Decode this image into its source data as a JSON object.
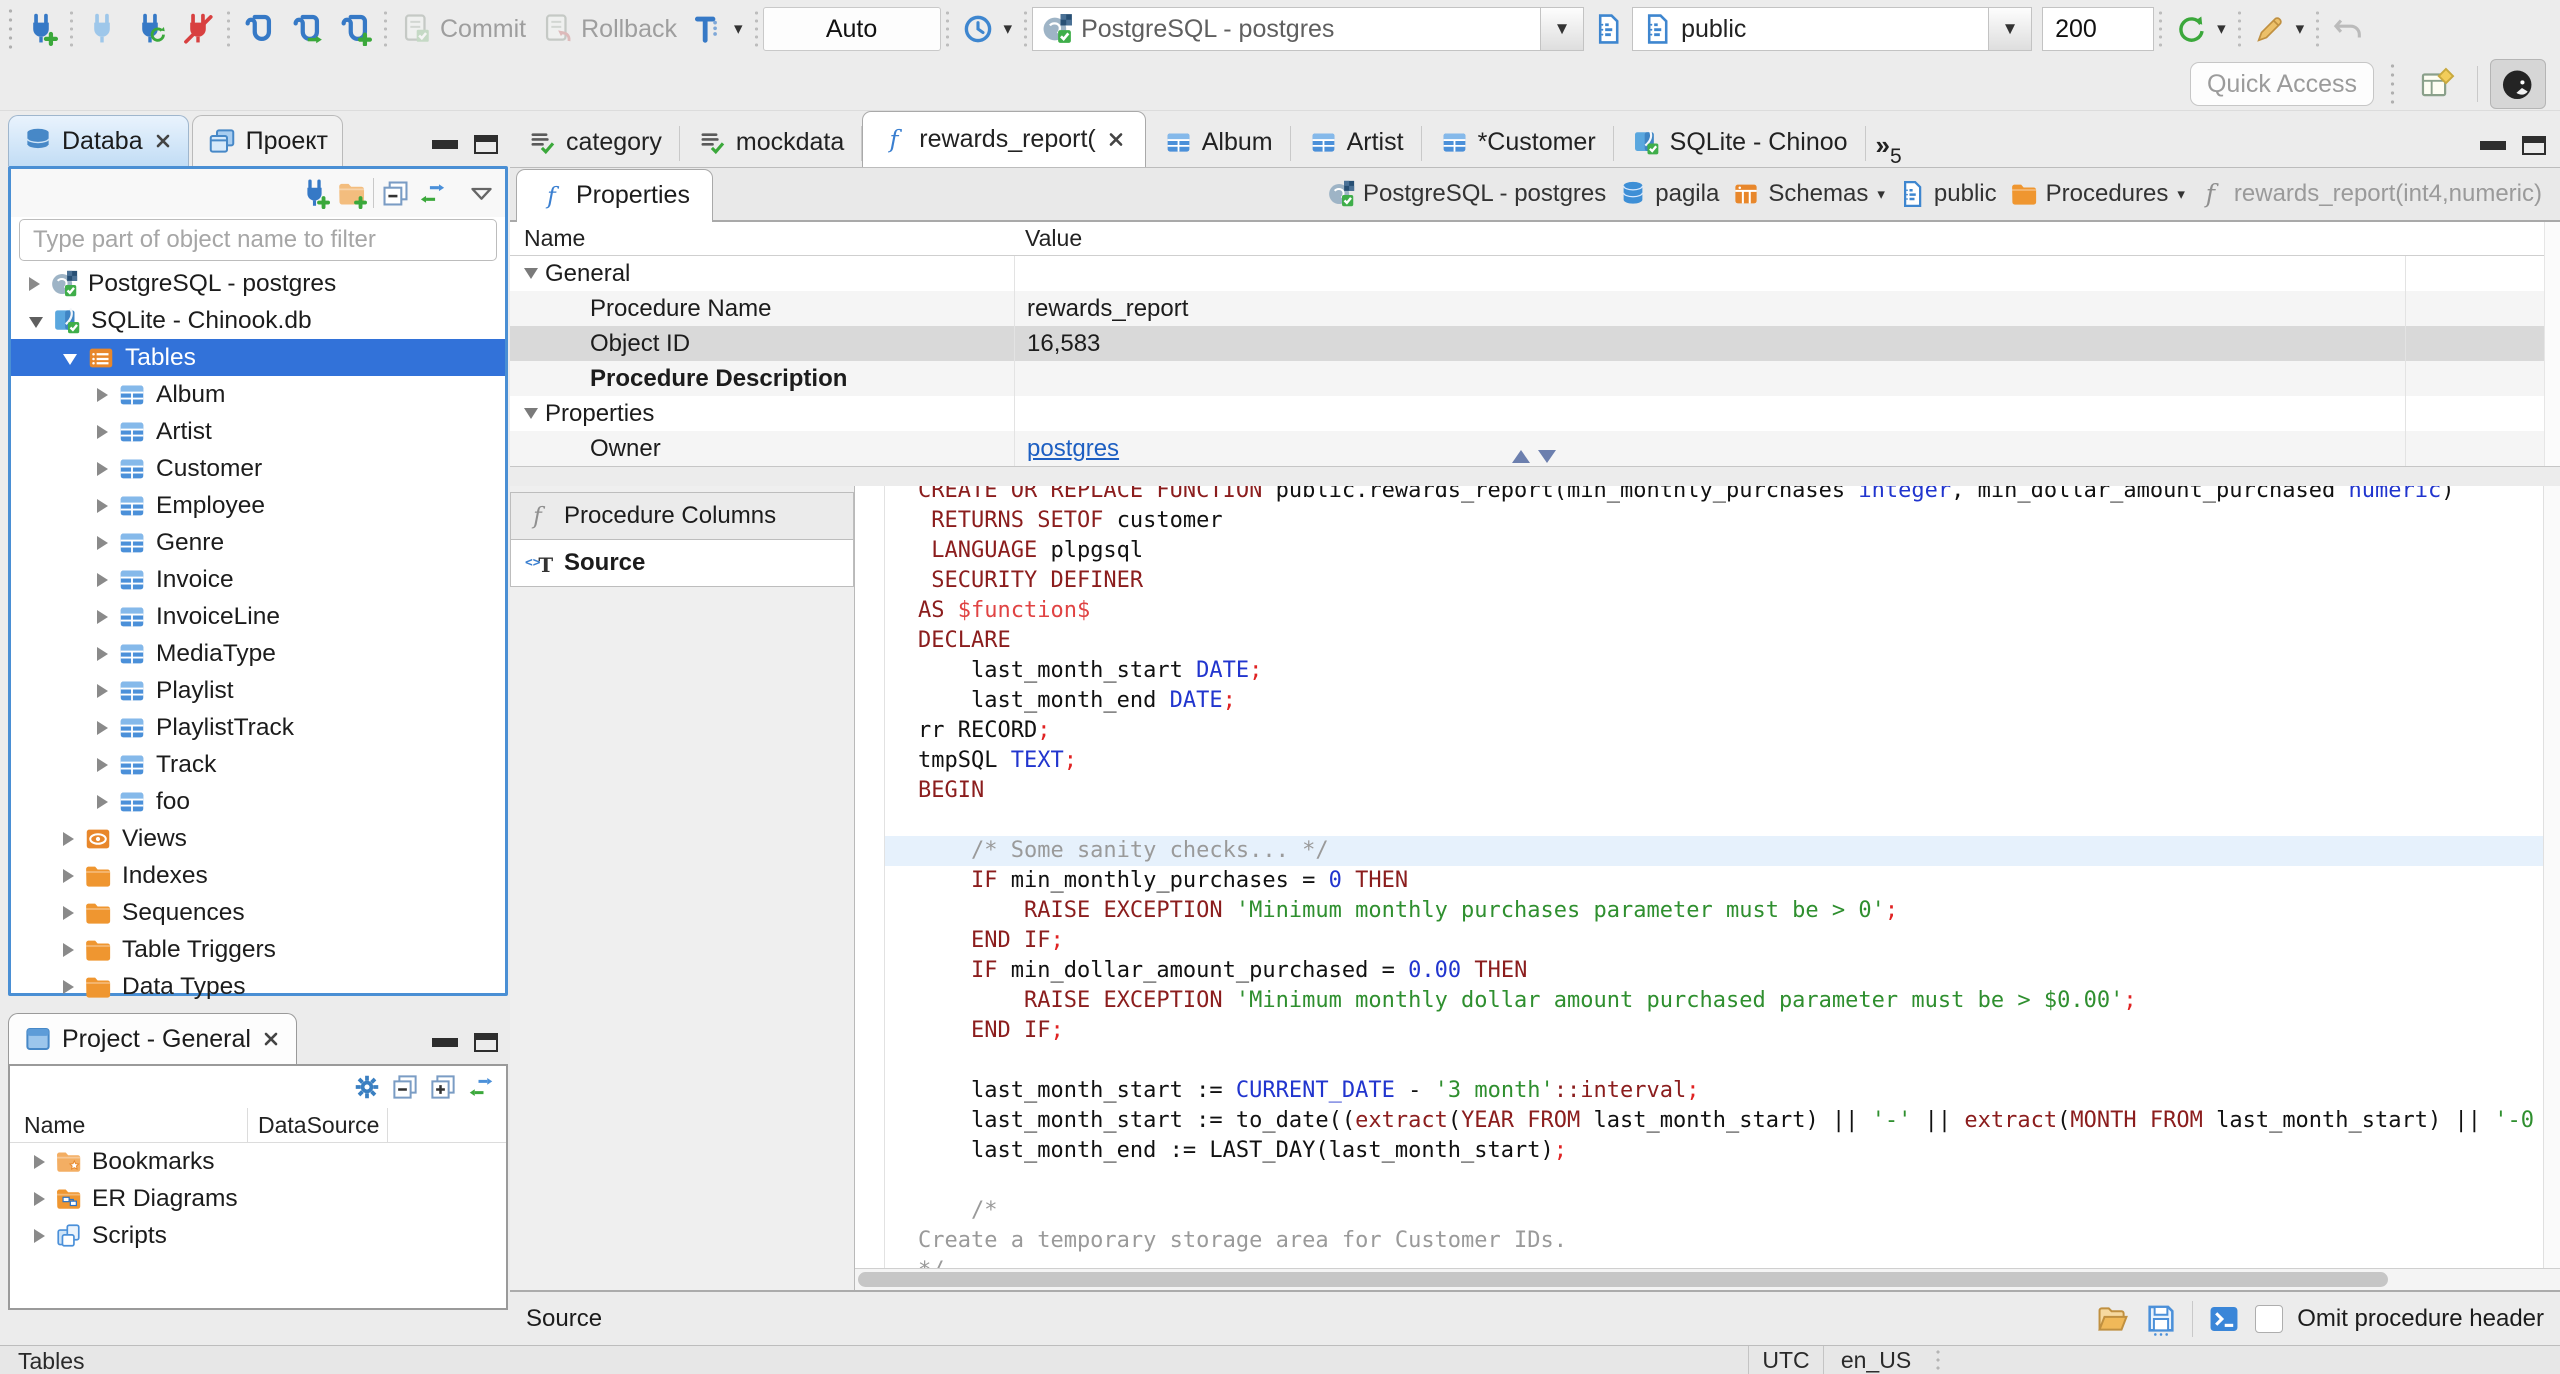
{
  "toolbar": {
    "commit_label": "Commit",
    "rollback_label": "Rollback",
    "auto_label": "Auto",
    "connection_combo": "PostgreSQL - postgres",
    "schema_combo": "public",
    "limit_value": "200",
    "quick_access_placeholder": "Quick Access"
  },
  "left_tabs": [
    {
      "label": "Databa",
      "icon": "database-stack",
      "closable": true,
      "active": true
    },
    {
      "label": "Проект",
      "icon": "project-windows",
      "active": false
    }
  ],
  "navigator": {
    "filter_placeholder": "Type part of object name to filter",
    "tree": [
      {
        "label": "PostgreSQL - postgres",
        "icon": "postgres-connection",
        "depth": 0,
        "state": "collapsed"
      },
      {
        "label": "SQLite - Chinook.db",
        "icon": "sqlite-connection",
        "depth": 0,
        "state": "expanded"
      },
      {
        "label": "Tables",
        "icon": "tables-folder",
        "depth": 1,
        "state": "expanded",
        "selected": true
      },
      {
        "label": "Album",
        "icon": "table",
        "depth": 2,
        "state": "collapsed"
      },
      {
        "label": "Artist",
        "icon": "table",
        "depth": 2,
        "state": "collapsed"
      },
      {
        "label": "Customer",
        "icon": "table",
        "depth": 2,
        "state": "collapsed"
      },
      {
        "label": "Employee",
        "icon": "table",
        "depth": 2,
        "state": "collapsed"
      },
      {
        "label": "Genre",
        "icon": "table",
        "depth": 2,
        "state": "collapsed"
      },
      {
        "label": "Invoice",
        "icon": "table",
        "depth": 2,
        "state": "collapsed"
      },
      {
        "label": "InvoiceLine",
        "icon": "table",
        "depth": 2,
        "state": "collapsed"
      },
      {
        "label": "MediaType",
        "icon": "table",
        "depth": 2,
        "state": "collapsed"
      },
      {
        "label": "Playlist",
        "icon": "table",
        "depth": 2,
        "state": "collapsed"
      },
      {
        "label": "PlaylistTrack",
        "icon": "table",
        "depth": 2,
        "state": "collapsed"
      },
      {
        "label": "Track",
        "icon": "table",
        "depth": 2,
        "state": "collapsed"
      },
      {
        "label": "foo",
        "icon": "table",
        "depth": 2,
        "state": "collapsed"
      },
      {
        "label": "Views",
        "icon": "views",
        "depth": 1,
        "state": "collapsed"
      },
      {
        "label": "Indexes",
        "icon": "folder",
        "depth": 1,
        "state": "collapsed"
      },
      {
        "label": "Sequences",
        "icon": "folder",
        "depth": 1,
        "state": "collapsed"
      },
      {
        "label": "Table Triggers",
        "icon": "folder",
        "depth": 1,
        "state": "collapsed"
      },
      {
        "label": "Data Types",
        "icon": "folder",
        "depth": 1,
        "state": "collapsed"
      }
    ]
  },
  "project_panel": {
    "tab_label": "Project - General",
    "columns": [
      "Name",
      "DataSource"
    ],
    "items": [
      {
        "label": "Bookmarks",
        "icon": "bookmarks-folder"
      },
      {
        "label": "ER Diagrams",
        "icon": "er-diagrams-folder"
      },
      {
        "label": "Scripts",
        "icon": "scripts"
      }
    ]
  },
  "editor_tabs": [
    {
      "label": "category",
      "icon": "sql-script-check"
    },
    {
      "label": "mockdata",
      "icon": "sql-script-check"
    },
    {
      "label": "rewards_report(",
      "icon": "function-blue",
      "active": true,
      "closable": true
    },
    {
      "label": "Album",
      "icon": "table"
    },
    {
      "label": "Artist",
      "icon": "table"
    },
    {
      "label": "*Customer",
      "icon": "table"
    },
    {
      "label": "SQLite - Chinoo",
      "icon": "sqlite-file"
    }
  ],
  "editor_tabs_overflow": {
    "symbol": "»",
    "count": "5"
  },
  "properties_view": {
    "tab_label": "Properties",
    "columns": [
      "Name",
      "Value"
    ],
    "breadcrumb": [
      {
        "label": "PostgreSQL - postgres",
        "icon": "postgres-connection"
      },
      {
        "label": "pagila",
        "icon": "database-blue"
      },
      {
        "label": "Schemas",
        "icon": "schemas-grid",
        "caret": true
      },
      {
        "label": "public",
        "icon": "schema-document"
      },
      {
        "label": "Procedures",
        "icon": "folder",
        "caret": true
      },
      {
        "label": "rewards_report(int4,numeric)",
        "icon": "function-gray",
        "dim": true
      }
    ],
    "rows": [
      {
        "name": "General",
        "group": true
      },
      {
        "name": "Procedure Name",
        "value": "rewards_report",
        "shade": true
      },
      {
        "name": "Object ID",
        "value": "16,583",
        "selected": true
      },
      {
        "name": "Procedure Description",
        "bold": true,
        "shade": true
      },
      {
        "name": "Properties",
        "group": true
      },
      {
        "name": "Owner",
        "value": "postgres",
        "link": true,
        "shade": true
      }
    ]
  },
  "detail_tabs": [
    {
      "label": "Procedure Columns",
      "icon": "function-gray"
    },
    {
      "label": "Source",
      "icon": "source-code",
      "active": true
    }
  ],
  "source_editor": {
    "lines": [
      {
        "segs": [
          [
            "kw",
            "CREATE OR REPLACE FUNCTION "
          ],
          [
            "pl",
            "public.rewards_report(min_monthly_purchases "
          ],
          [
            "ty",
            "integer"
          ],
          [
            "pl",
            ", min_dollar_amount_purchased "
          ],
          [
            "ty",
            "numeric"
          ],
          [
            "pl",
            ")"
          ]
        ]
      },
      {
        "segs": [
          [
            "kw",
            " RETURNS SETOF "
          ],
          [
            "pl",
            "customer"
          ]
        ]
      },
      {
        "segs": [
          [
            "kw",
            " LANGUAGE "
          ],
          [
            "pl",
            "plpgsql"
          ]
        ]
      },
      {
        "segs": [
          [
            "kw",
            " SECURITY DEFINER"
          ]
        ]
      },
      {
        "segs": [
          [
            "kw",
            "AS "
          ],
          [
            "fn",
            "$function$"
          ]
        ]
      },
      {
        "segs": [
          [
            "kw",
            "DECLARE"
          ]
        ]
      },
      {
        "segs": [
          [
            "pl",
            "    last_month_start "
          ],
          [
            "ty",
            "DATE"
          ],
          [
            "pu",
            ";"
          ]
        ]
      },
      {
        "segs": [
          [
            "pl",
            "    last_month_end "
          ],
          [
            "ty",
            "DATE"
          ],
          [
            "pu",
            ";"
          ]
        ]
      },
      {
        "segs": [
          [
            "pl",
            "rr RECORD"
          ],
          [
            "pu",
            ";"
          ]
        ]
      },
      {
        "segs": [
          [
            "pl",
            "tmpSQL "
          ],
          [
            "ty",
            "TEXT"
          ],
          [
            "pu",
            ";"
          ]
        ]
      },
      {
        "segs": [
          [
            "kw",
            "BEGIN"
          ]
        ]
      },
      {
        "segs": []
      },
      {
        "hl": true,
        "segs": [
          [
            "cm",
            "    /* Some sanity checks... */"
          ]
        ]
      },
      {
        "segs": [
          [
            "pl",
            "    "
          ],
          [
            "kw",
            "IF"
          ],
          [
            "pl",
            " min_monthly_purchases = "
          ],
          [
            "nu",
            "0"
          ],
          [
            "pl",
            " "
          ],
          [
            "kw",
            "THEN"
          ]
        ]
      },
      {
        "segs": [
          [
            "pl",
            "        "
          ],
          [
            "kw",
            "RAISE EXCEPTION "
          ],
          [
            "st",
            "'Minimum monthly purchases parameter must be > 0'"
          ],
          [
            "pu",
            ";"
          ]
        ]
      },
      {
        "segs": [
          [
            "pl",
            "    "
          ],
          [
            "kw",
            "END IF"
          ],
          [
            "pu",
            ";"
          ]
        ]
      },
      {
        "segs": [
          [
            "pl",
            "    "
          ],
          [
            "kw",
            "IF"
          ],
          [
            "pl",
            " min_dollar_amount_purchased = "
          ],
          [
            "nu",
            "0.00"
          ],
          [
            "pl",
            " "
          ],
          [
            "kw",
            "THEN"
          ]
        ]
      },
      {
        "segs": [
          [
            "pl",
            "        "
          ],
          [
            "kw",
            "RAISE EXCEPTION "
          ],
          [
            "st",
            "'Minimum monthly dollar amount purchased parameter must be > $0.00'"
          ],
          [
            "pu",
            ";"
          ]
        ]
      },
      {
        "segs": [
          [
            "pl",
            "    "
          ],
          [
            "kw",
            "END IF"
          ],
          [
            "pu",
            ";"
          ]
        ]
      },
      {
        "segs": []
      },
      {
        "segs": [
          [
            "pl",
            "    last_month_start := "
          ],
          [
            "ty",
            "CURRENT_DATE"
          ],
          [
            "pl",
            " - "
          ],
          [
            "st",
            "'3 month'"
          ],
          [
            "kw",
            "::interval"
          ],
          [
            "pu",
            ";"
          ]
        ]
      },
      {
        "segs": [
          [
            "pl",
            "    last_month_start := to_date(("
          ],
          [
            "kw",
            "extract"
          ],
          [
            "pl",
            "("
          ],
          [
            "kw",
            "YEAR FROM"
          ],
          [
            "pl",
            " last_month_start) || "
          ],
          [
            "st",
            "'-'"
          ],
          [
            "pl",
            " || "
          ],
          [
            "kw",
            "extract"
          ],
          [
            "pl",
            "("
          ],
          [
            "kw",
            "MONTH FROM"
          ],
          [
            "pl",
            " last_month_start) || "
          ],
          [
            "st",
            "'-0"
          ]
        ]
      },
      {
        "segs": [
          [
            "pl",
            "    last_month_end := LAST_DAY(last_month_start)"
          ],
          [
            "pu",
            ";"
          ]
        ]
      },
      {
        "segs": []
      },
      {
        "segs": [
          [
            "cm",
            "    /*"
          ]
        ]
      },
      {
        "segs": [
          [
            "cm",
            "Create a temporary storage area for Customer IDs."
          ]
        ]
      },
      {
        "segs": [
          [
            "cm",
            "*/"
          ]
        ]
      }
    ]
  },
  "editor_status": {
    "label": "Source",
    "omit_checkbox_label": "Omit procedure header"
  },
  "status_bar": {
    "left": "Tables",
    "timezone": "UTC",
    "locale": "en_US"
  },
  "colors": {
    "accent_blue": "#3272d9",
    "focus_border": "#4a8fd4",
    "selection_gray": "#d9d9d9",
    "keyword": "#8b1d1d",
    "type": "#2135ce",
    "string": "#2f8f2f",
    "comment": "#9a9a9a",
    "punct_red": "#e02222"
  }
}
